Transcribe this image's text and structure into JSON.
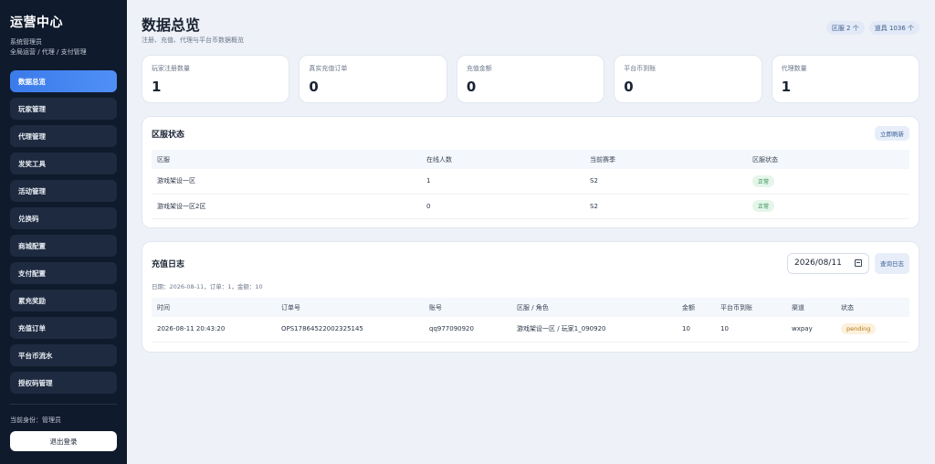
{
  "sidebar": {
    "title": "运营中心",
    "subtitle_line1": "系统管理员",
    "subtitle_line2": "全局运营 / 代理 / 支付管理",
    "items": [
      {
        "label": "数据总览",
        "active": true
      },
      {
        "label": "玩家管理"
      },
      {
        "label": "代理管理"
      },
      {
        "label": "发奖工具"
      },
      {
        "label": "活动管理"
      },
      {
        "label": "兑换码"
      },
      {
        "label": "商城配置"
      },
      {
        "label": "支付配置"
      },
      {
        "label": "累充奖励"
      },
      {
        "label": "充值订单"
      },
      {
        "label": "平台币流水"
      },
      {
        "label": "授权码管理"
      }
    ],
    "role_text": "当前身份：管理员",
    "logout_label": "退出登录"
  },
  "header": {
    "title": "数据总览",
    "subtitle": "注册、充值、代理与平台币数据概览",
    "pill_servers": "区服 2 个",
    "pill_items": "道具 1036 个"
  },
  "stats": [
    {
      "label": "玩家注册数量",
      "value": "1"
    },
    {
      "label": "真实充值订单",
      "value": "0"
    },
    {
      "label": "充值金额",
      "value": "0"
    },
    {
      "label": "平台币到账",
      "value": "0"
    },
    {
      "label": "代理数量",
      "value": "1"
    }
  ],
  "server_status": {
    "title": "区服状态",
    "refresh_label": "立即刷新",
    "columns": [
      "区服",
      "在线人数",
      "当前赛季",
      "区服状态"
    ],
    "rows": [
      {
        "name": "游戏架设一区",
        "online": "1",
        "season": "S2",
        "status": "正常"
      },
      {
        "name": "游戏架设一区2区",
        "online": "0",
        "season": "S2",
        "status": "正常"
      }
    ]
  },
  "recharge_log": {
    "title": "充值日志",
    "date_value": "2026/08/11",
    "query_label": "查询日志",
    "summary": "日期：2026-08-11，订单：1，金额：10",
    "columns": [
      "时间",
      "订单号",
      "账号",
      "区服 / 角色",
      "金额",
      "平台币到账",
      "渠道",
      "状态"
    ],
    "rows": [
      {
        "time": "2026-08-11 20:43:20",
        "order": "OPS17864522002325145",
        "account": "qq977090920",
        "server_role": "游戏架设一区 / 玩家1_090920",
        "amount": "10",
        "coins": "10",
        "channel": "wxpay",
        "status": "pending"
      }
    ]
  },
  "colors": {
    "sidebar_bg": "#0f1a2c",
    "accent": "#3b7bea",
    "status_ok": "#2d8a4c",
    "status_pending": "#b07a1c"
  }
}
